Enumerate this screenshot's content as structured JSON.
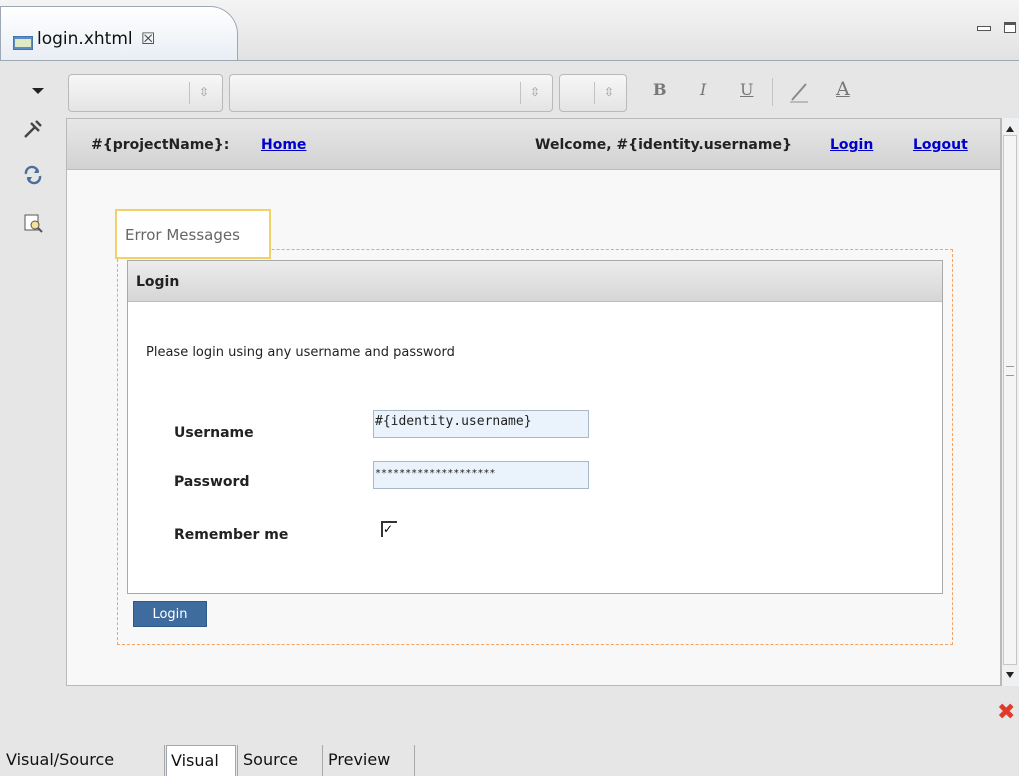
{
  "tab": {
    "title": "login.xhtml",
    "close_glyph": "☒",
    "file_icon": "html-file-icon"
  },
  "toolbar": {
    "bold": "B",
    "italic": "I",
    "underline": "U",
    "highlight": "⁄",
    "font_color": "A",
    "combo_spin": "⇳"
  },
  "side_icons": [
    "tools-icon",
    "refresh-icon",
    "preview-icon"
  ],
  "page": {
    "project": "#{projectName}:",
    "home": "Home",
    "welcome": "Welcome, #{identity.username}",
    "login_link": "Login",
    "logout_link": "Logout",
    "error_messages": "Error Messages",
    "panel_title": "Login",
    "instruction": "Please login using any username and password",
    "username_label": "Username",
    "username_value": "#{identity.username}",
    "password_label": "Password",
    "password_value": "********************",
    "remember_label": "Remember me",
    "remember_checked": true,
    "checkmark": "✓",
    "submit_label": "Login"
  },
  "bottom_tabs": {
    "visual_source": "Visual/Source",
    "visual": "Visual",
    "source": "Source",
    "preview": "Preview"
  },
  "close_glyph": "✖"
}
